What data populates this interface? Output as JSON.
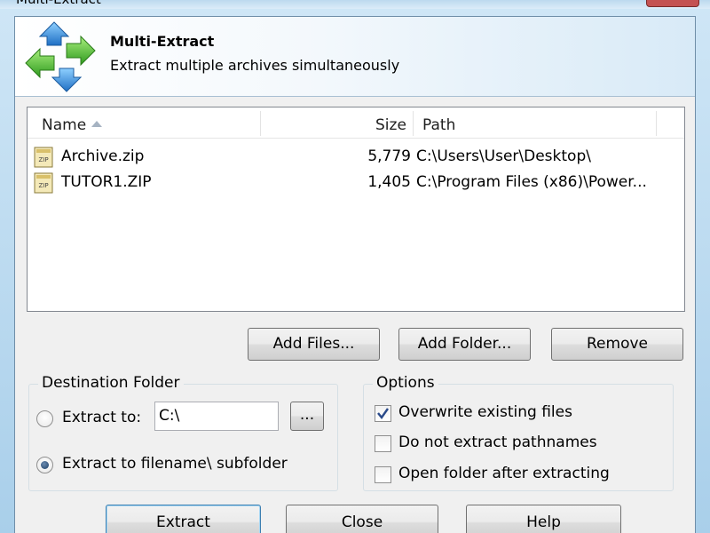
{
  "window": {
    "title": "Multi-Extract"
  },
  "header": {
    "title": "Multi-Extract",
    "subtitle": "Extract multiple archives simultaneously",
    "icon": "arrows-icon"
  },
  "file_list": {
    "columns": {
      "name": "Name",
      "size": "Size",
      "path": "Path"
    },
    "sort_column": "name",
    "rows": [
      {
        "icon": "zip-file-icon",
        "name": "Archive.zip",
        "size": "5,779",
        "path": "C:\\Users\\User\\Desktop\\"
      },
      {
        "icon": "zip-file-icon",
        "name": "TUTOR1.ZIP",
        "size": "1,405",
        "path": "C:\\Program Files (x86)\\Power..."
      }
    ]
  },
  "list_buttons": {
    "add_files": "Add Files...",
    "add_folder": "Add Folder...",
    "remove": "Remove"
  },
  "destination": {
    "group_label": "Destination Folder",
    "extract_to_label": "Extract to:",
    "extract_to_value": "C:\\",
    "browse_label": "...",
    "subfolder_label": "Extract to filename\\ subfolder",
    "selected": "subfolder"
  },
  "options": {
    "group_label": "Options",
    "items": [
      {
        "label": "Overwrite existing files",
        "checked": true
      },
      {
        "label": "Do not extract pathnames",
        "checked": false
      },
      {
        "label": "Open folder after extracting",
        "checked": false
      }
    ]
  },
  "footer_buttons": {
    "extract": "Extract",
    "close": "Close",
    "help": "Help"
  }
}
